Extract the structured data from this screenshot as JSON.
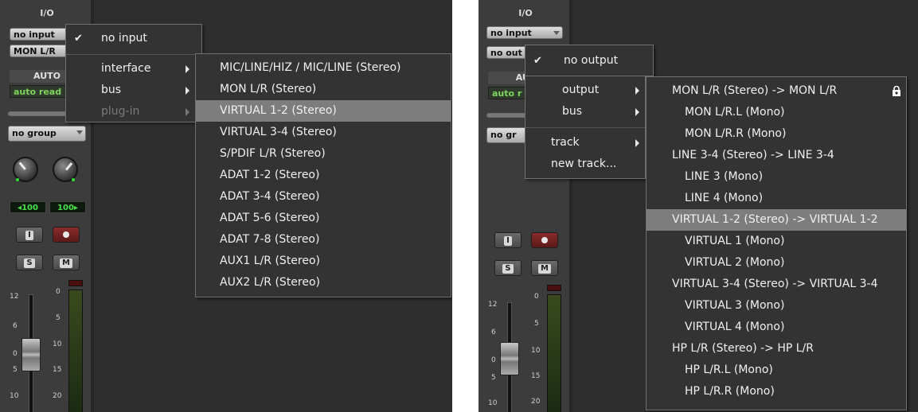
{
  "left": {
    "strip": {
      "io_header": "I/O",
      "input_selector": "no input",
      "output_selector": "MON L/R",
      "auto_header": "AUTO",
      "auto_value": "auto read",
      "group_selector": "no group",
      "pan_left": "◂100",
      "pan_right": "100▸",
      "input_button": "I",
      "solo_button": "S",
      "mute_button": "M",
      "fader_scale": [
        "12",
        "6",
        "0",
        "5",
        "10"
      ],
      "meter_scale": [
        "0",
        "5",
        "10",
        "15",
        "20"
      ]
    },
    "menu": {
      "checked_item": "no input",
      "items": [
        "interface",
        "bus",
        "plug-in"
      ]
    },
    "submenu": {
      "items": [
        "MIC/LINE/HIZ / MIC/LINE (Stereo)",
        "MON L/R (Stereo)",
        "VIRTUAL 1-2 (Stereo)",
        "VIRTUAL 3-4 (Stereo)",
        "S/PDIF L/R (Stereo)",
        "ADAT 1-2 (Stereo)",
        "ADAT 3-4 (Stereo)",
        "ADAT 5-6 (Stereo)",
        "ADAT 7-8 (Stereo)",
        "AUX1 L/R (Stereo)",
        "AUX2 L/R (Stereo)"
      ],
      "highlighted": "VIRTUAL 1-2 (Stereo)"
    }
  },
  "right": {
    "strip": {
      "io_header": "I/O",
      "input_selector": "no input",
      "output_selector": "no out",
      "auto_header": "AUT",
      "auto_value": "auto r",
      "group_selector": "no gr",
      "input_button": "I",
      "solo_button": "S",
      "mute_button": "M",
      "fader_scale": [
        "12",
        "6",
        "0",
        "5",
        "10"
      ],
      "meter_scale": [
        "0",
        "5",
        "10",
        "15",
        "20"
      ]
    },
    "menu": {
      "checked_item": "no output",
      "items": [
        "output",
        "bus",
        "track",
        "new track..."
      ]
    },
    "submenu": {
      "items": [
        "MON L/R (Stereo) -> MON L/R",
        "MON L/R.L (Mono)",
        "MON L/R.R (Mono)",
        "LINE 3-4 (Stereo) -> LINE 3-4",
        "LINE 3 (Mono)",
        "LINE 4 (Mono)",
        "VIRTUAL 1-2 (Stereo) -> VIRTUAL 1-2",
        "VIRTUAL 1 (Mono)",
        "VIRTUAL 2 (Mono)",
        "VIRTUAL 3-4 (Stereo) -> VIRTUAL 3-4",
        "VIRTUAL 3 (Mono)",
        "VIRTUAL 4 (Mono)",
        "HP L/R (Stereo) -> HP L/R",
        "HP L/R.L (Mono)",
        "HP L/R.R (Mono)"
      ],
      "highlighted": "VIRTUAL 1-2 (Stereo) -> VIRTUAL 1-2",
      "lock_icon": "lock-icon"
    }
  },
  "colors": {
    "panel_bg": "#2e2e2e",
    "strip_bg": "#3c3c3c",
    "menu_bg": "#333333",
    "highlight": "#7d7d7d",
    "auto_green": "#7ed55c",
    "pan_green": "#48e048"
  }
}
